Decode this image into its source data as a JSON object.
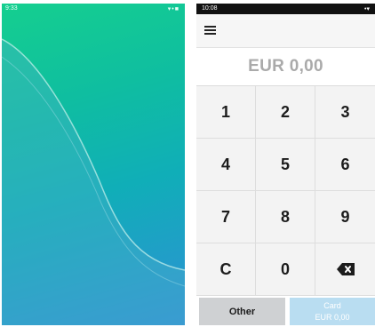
{
  "left_screen": {
    "status_time": "9:33",
    "status_icons": "▾•■"
  },
  "right_screen": {
    "status_time": "10:08",
    "status_icons": "•▾",
    "amount_display": "EUR 0,00",
    "keypad": {
      "keys": [
        "1",
        "2",
        "3",
        "4",
        "5",
        "6",
        "7",
        "8",
        "9",
        "C",
        "0",
        "backspace"
      ]
    },
    "buttons": {
      "other_label": "Other",
      "card_label": "Card",
      "card_amount": "EUR 0,00"
    }
  },
  "colors": {
    "amount_text": "#aaaaaa",
    "card_button": "#b9ddf1",
    "other_button": "#cfd1d3",
    "wallpaper_top": "#15cf8f",
    "wallpaper_bottom": "#2f90d6"
  }
}
